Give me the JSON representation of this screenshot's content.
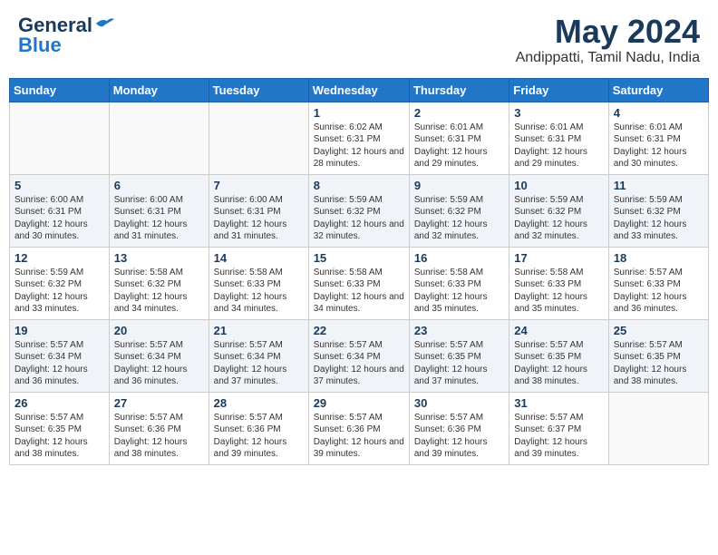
{
  "logo": {
    "text_general": "General",
    "text_blue": "Blue"
  },
  "title": {
    "month_year": "May 2024",
    "location": "Andippatti, Tamil Nadu, India"
  },
  "days_of_week": [
    "Sunday",
    "Monday",
    "Tuesday",
    "Wednesday",
    "Thursday",
    "Friday",
    "Saturday"
  ],
  "weeks": [
    [
      {
        "day": "",
        "sunrise": "",
        "sunset": "",
        "daylight": "",
        "empty": true
      },
      {
        "day": "",
        "sunrise": "",
        "sunset": "",
        "daylight": "",
        "empty": true
      },
      {
        "day": "",
        "sunrise": "",
        "sunset": "",
        "daylight": "",
        "empty": true
      },
      {
        "day": "1",
        "sunrise": "Sunrise: 6:02 AM",
        "sunset": "Sunset: 6:31 PM",
        "daylight": "Daylight: 12 hours and 28 minutes."
      },
      {
        "day": "2",
        "sunrise": "Sunrise: 6:01 AM",
        "sunset": "Sunset: 6:31 PM",
        "daylight": "Daylight: 12 hours and 29 minutes."
      },
      {
        "day": "3",
        "sunrise": "Sunrise: 6:01 AM",
        "sunset": "Sunset: 6:31 PM",
        "daylight": "Daylight: 12 hours and 29 minutes."
      },
      {
        "day": "4",
        "sunrise": "Sunrise: 6:01 AM",
        "sunset": "Sunset: 6:31 PM",
        "daylight": "Daylight: 12 hours and 30 minutes."
      }
    ],
    [
      {
        "day": "5",
        "sunrise": "Sunrise: 6:00 AM",
        "sunset": "Sunset: 6:31 PM",
        "daylight": "Daylight: 12 hours and 30 minutes."
      },
      {
        "day": "6",
        "sunrise": "Sunrise: 6:00 AM",
        "sunset": "Sunset: 6:31 PM",
        "daylight": "Daylight: 12 hours and 31 minutes."
      },
      {
        "day": "7",
        "sunrise": "Sunrise: 6:00 AM",
        "sunset": "Sunset: 6:31 PM",
        "daylight": "Daylight: 12 hours and 31 minutes."
      },
      {
        "day": "8",
        "sunrise": "Sunrise: 5:59 AM",
        "sunset": "Sunset: 6:32 PM",
        "daylight": "Daylight: 12 hours and 32 minutes."
      },
      {
        "day": "9",
        "sunrise": "Sunrise: 5:59 AM",
        "sunset": "Sunset: 6:32 PM",
        "daylight": "Daylight: 12 hours and 32 minutes."
      },
      {
        "day": "10",
        "sunrise": "Sunrise: 5:59 AM",
        "sunset": "Sunset: 6:32 PM",
        "daylight": "Daylight: 12 hours and 32 minutes."
      },
      {
        "day": "11",
        "sunrise": "Sunrise: 5:59 AM",
        "sunset": "Sunset: 6:32 PM",
        "daylight": "Daylight: 12 hours and 33 minutes."
      }
    ],
    [
      {
        "day": "12",
        "sunrise": "Sunrise: 5:59 AM",
        "sunset": "Sunset: 6:32 PM",
        "daylight": "Daylight: 12 hours and 33 minutes."
      },
      {
        "day": "13",
        "sunrise": "Sunrise: 5:58 AM",
        "sunset": "Sunset: 6:32 PM",
        "daylight": "Daylight: 12 hours and 34 minutes."
      },
      {
        "day": "14",
        "sunrise": "Sunrise: 5:58 AM",
        "sunset": "Sunset: 6:33 PM",
        "daylight": "Daylight: 12 hours and 34 minutes."
      },
      {
        "day": "15",
        "sunrise": "Sunrise: 5:58 AM",
        "sunset": "Sunset: 6:33 PM",
        "daylight": "Daylight: 12 hours and 34 minutes."
      },
      {
        "day": "16",
        "sunrise": "Sunrise: 5:58 AM",
        "sunset": "Sunset: 6:33 PM",
        "daylight": "Daylight: 12 hours and 35 minutes."
      },
      {
        "day": "17",
        "sunrise": "Sunrise: 5:58 AM",
        "sunset": "Sunset: 6:33 PM",
        "daylight": "Daylight: 12 hours and 35 minutes."
      },
      {
        "day": "18",
        "sunrise": "Sunrise: 5:57 AM",
        "sunset": "Sunset: 6:33 PM",
        "daylight": "Daylight: 12 hours and 36 minutes."
      }
    ],
    [
      {
        "day": "19",
        "sunrise": "Sunrise: 5:57 AM",
        "sunset": "Sunset: 6:34 PM",
        "daylight": "Daylight: 12 hours and 36 minutes."
      },
      {
        "day": "20",
        "sunrise": "Sunrise: 5:57 AM",
        "sunset": "Sunset: 6:34 PM",
        "daylight": "Daylight: 12 hours and 36 minutes."
      },
      {
        "day": "21",
        "sunrise": "Sunrise: 5:57 AM",
        "sunset": "Sunset: 6:34 PM",
        "daylight": "Daylight: 12 hours and 37 minutes."
      },
      {
        "day": "22",
        "sunrise": "Sunrise: 5:57 AM",
        "sunset": "Sunset: 6:34 PM",
        "daylight": "Daylight: 12 hours and 37 minutes."
      },
      {
        "day": "23",
        "sunrise": "Sunrise: 5:57 AM",
        "sunset": "Sunset: 6:35 PM",
        "daylight": "Daylight: 12 hours and 37 minutes."
      },
      {
        "day": "24",
        "sunrise": "Sunrise: 5:57 AM",
        "sunset": "Sunset: 6:35 PM",
        "daylight": "Daylight: 12 hours and 38 minutes."
      },
      {
        "day": "25",
        "sunrise": "Sunrise: 5:57 AM",
        "sunset": "Sunset: 6:35 PM",
        "daylight": "Daylight: 12 hours and 38 minutes."
      }
    ],
    [
      {
        "day": "26",
        "sunrise": "Sunrise: 5:57 AM",
        "sunset": "Sunset: 6:35 PM",
        "daylight": "Daylight: 12 hours and 38 minutes."
      },
      {
        "day": "27",
        "sunrise": "Sunrise: 5:57 AM",
        "sunset": "Sunset: 6:36 PM",
        "daylight": "Daylight: 12 hours and 38 minutes."
      },
      {
        "day": "28",
        "sunrise": "Sunrise: 5:57 AM",
        "sunset": "Sunset: 6:36 PM",
        "daylight": "Daylight: 12 hours and 39 minutes."
      },
      {
        "day": "29",
        "sunrise": "Sunrise: 5:57 AM",
        "sunset": "Sunset: 6:36 PM",
        "daylight": "Daylight: 12 hours and 39 minutes."
      },
      {
        "day": "30",
        "sunrise": "Sunrise: 5:57 AM",
        "sunset": "Sunset: 6:36 PM",
        "daylight": "Daylight: 12 hours and 39 minutes."
      },
      {
        "day": "31",
        "sunrise": "Sunrise: 5:57 AM",
        "sunset": "Sunset: 6:37 PM",
        "daylight": "Daylight: 12 hours and 39 minutes."
      },
      {
        "day": "",
        "sunrise": "",
        "sunset": "",
        "daylight": "",
        "empty": true
      }
    ]
  ]
}
